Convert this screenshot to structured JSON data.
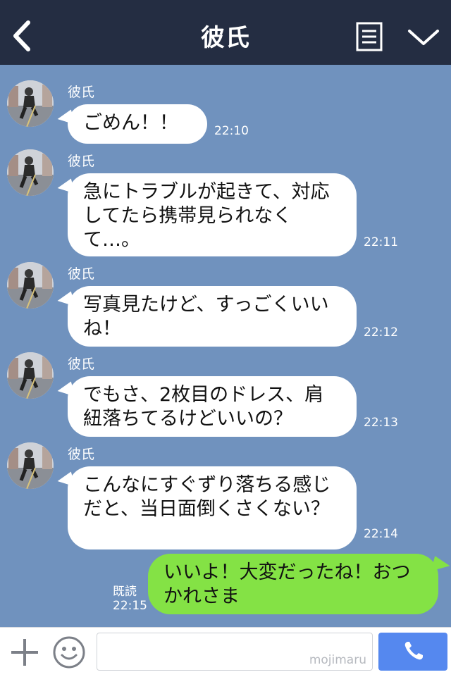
{
  "header": {
    "title": "彼氏"
  },
  "messages": [
    {
      "sender": "彼氏",
      "text": "ごめん！！",
      "time": "22:10"
    },
    {
      "sender": "彼氏",
      "text": "急にトラブルが起きて、対応してたら携帯見られなくて…。",
      "time": "22:11"
    },
    {
      "sender": "彼氏",
      "text": "写真見たけど、すっごくいいね！",
      "time": "22:12"
    },
    {
      "sender": "彼氏",
      "text": "でもさ、2枚目のドレス、肩紐落ちてるけどいいの？",
      "time": "22:13"
    },
    {
      "sender": "彼氏",
      "text": "こんなにすぐずり落ちる感じだと、当日面倒くさくない？",
      "time": "22:14"
    }
  ],
  "my_message": {
    "text": "いいよ！大変だったね！おつかれさま",
    "read_label": "既読",
    "time": "22:15"
  },
  "input": {
    "watermark": "mojimaru",
    "placeholder": ""
  },
  "icons": {
    "back": "back-chevron-icon",
    "menu": "menu-list-icon",
    "collapse": "chevron-down-icon",
    "add": "plus-icon",
    "emoji": "emoji-smile-icon",
    "call": "phone-icon"
  },
  "colors": {
    "header_bg": "#242d42",
    "chat_bg": "#7092be",
    "incoming_bubble": "#ffffff",
    "outgoing_bubble": "#84e245",
    "call_button": "#5588ef"
  }
}
